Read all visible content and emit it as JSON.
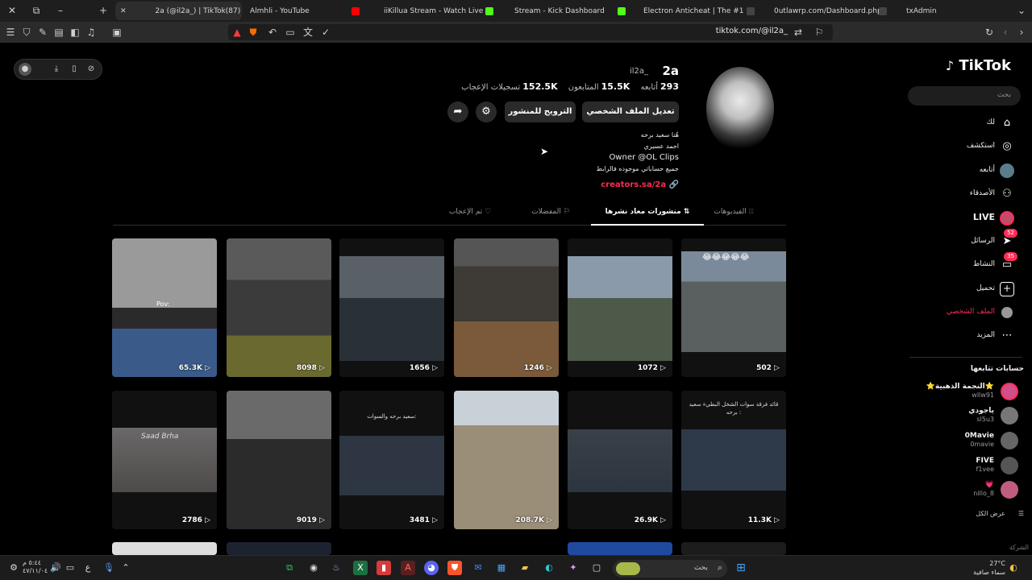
{
  "browser": {
    "tabs": [
      {
        "title": "2a (@il2a_) | TikTok(87)",
        "active": true,
        "fav": "#010101"
      },
      {
        "title": "Almhli - YouTube",
        "active": false,
        "fav": "#ff0000"
      },
      {
        "title": "iiKillua Stream - Watch Live on Ki",
        "active": false,
        "fav": "#53fc18"
      },
      {
        "title": "Stream - Kick Dashboard",
        "active": false,
        "fav": "#53fc18"
      },
      {
        "title": "Electron Anticheat | The #1 FiveM A",
        "active": false,
        "fav": "#444444"
      },
      {
        "title": "0utlawrp.com/Dashboard.php",
        "active": false,
        "fav": "#444444"
      },
      {
        "title": "txAdmin",
        "active": false,
        "fav": "#444444"
      }
    ],
    "url": "tiktok.com/@il2a_"
  },
  "sidebar": {
    "logo": "TikTok",
    "search_placeholder": "بحث",
    "nav": [
      {
        "label": "لك",
        "icon": "home-icon",
        "glyph": "⌂"
      },
      {
        "label": "استكشف",
        "icon": "compass-icon",
        "glyph": "◎"
      },
      {
        "label": "أتابعه",
        "icon": "following-icon",
        "glyph": "●"
      },
      {
        "label": "الأصدقاء",
        "icon": "friends-icon",
        "glyph": "⚇"
      },
      {
        "label": "LIVE",
        "icon": "live-icon",
        "glyph": "◉"
      },
      {
        "label": "الرسائل",
        "icon": "messages-icon",
        "glyph": "➤",
        "badge": "52"
      },
      {
        "label": "النشاط",
        "icon": "activity-icon",
        "glyph": "▭",
        "badge": "35"
      },
      {
        "label": "تحميل",
        "icon": "upload-icon",
        "glyph": "+"
      },
      {
        "label": "الملف الشخصي",
        "icon": "profile-icon",
        "glyph": "●"
      },
      {
        "label": "المزيد",
        "icon": "more-icon",
        "glyph": "⋯"
      }
    ],
    "following_header": "حسابات تتابعها",
    "following": [
      {
        "name": "⭐النجمة الذهبية⭐",
        "handle": "wllw91",
        "color": "#d14f8a"
      },
      {
        "name": "ياجودي",
        "handle": "sl5u3",
        "color": "#777777"
      },
      {
        "name": "0Mavie",
        "handle": "0mavie",
        "color": "#666666"
      },
      {
        "name": "FIVE",
        "handle": "f1vee",
        "color": "#555555"
      },
      {
        "name": "💗",
        "handle": "nillo_8",
        "color": "#c05d7e"
      }
    ],
    "see_all": "عرض الكل",
    "footer": "الشركة"
  },
  "profile": {
    "username": "2a",
    "nickname": "il2a_",
    "stats": [
      {
        "value": "293",
        "label": "أتابعه"
      },
      {
        "value": "15.5K",
        "label": "المتابعون"
      },
      {
        "value": "152.5K",
        "label": "تسجيلات الإعجاب"
      }
    ],
    "edit_button": "تعديل الملف الشخصي",
    "promote_button": "الترويج للمنشور",
    "bio": [
      "هُنا سعيد برحه",
      "احمد عسيري",
      "Owner @OL Clips",
      "جميع حساباتي موجوده فالرابط"
    ],
    "link": "creators.sa/2a"
  },
  "tabs": {
    "videos": "الفيديوهات",
    "reposts": "منشورات معاد نشرها",
    "favorites": "المفضلات",
    "liked": "تم الإعجاب"
  },
  "videos": [
    {
      "views": "502",
      "color": "#5a6470"
    },
    {
      "views": "1072",
      "color": "#4d5a4a"
    },
    {
      "views": "1246",
      "color": "#3e3a36"
    },
    {
      "views": "1656",
      "color": "#3a4048"
    },
    {
      "views": "8098",
      "color": "#3b3b3b"
    },
    {
      "views": "65.3K",
      "color": "#6a6a6a"
    },
    {
      "views": "11.3K",
      "color": "#2e3a4a"
    },
    {
      "views": "26.9K",
      "color": "#2c3540"
    },
    {
      "views": "208.7K",
      "color": "#9a8e78"
    },
    {
      "views": "3481",
      "color": "#2d3642"
    },
    {
      "views": "9019",
      "color": "#2b2b2b"
    },
    {
      "views": "2786",
      "color": "#4e4a4a"
    }
  ],
  "video_captions": {
    "tile1_pov": "Pov:",
    "tile12_name": "Saad Brha",
    "tile9_text": "سعيد برحه والسوات:",
    "tile7_text": "قائد فرقة سوات الشخل البطيء سعيد برحه :"
  },
  "taskbar": {
    "search": "بحث",
    "temperature": "27°C",
    "weather": "سماء صافية",
    "date": "٤٧/١١/٠٤",
    "time": "٥:٤٤ م"
  }
}
